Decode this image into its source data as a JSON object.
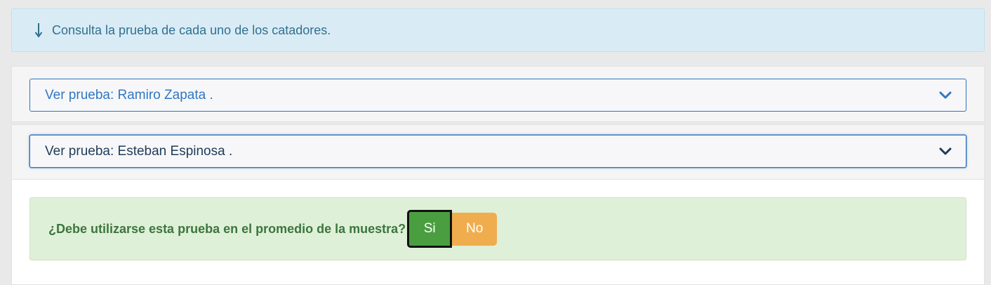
{
  "info_alert": {
    "icon": "arrow-down-icon",
    "text": "Consulta la prueba de cada uno de los catadores."
  },
  "accordion": [
    {
      "label": "Ver prueba: Ramiro Zapata .",
      "icon": "chevron-down-icon",
      "expanded": false
    },
    {
      "label": "Ver prueba: Esteban Espinosa .",
      "icon": "chevron-down-icon",
      "expanded": true
    }
  ],
  "usage_question": {
    "text": "¿Debe utilizarse esta prueba en el promedio de la muestra?",
    "yes_label": "Si",
    "no_label": "No",
    "selected": "Si"
  },
  "colors": {
    "info_bg": "#d9ecf6",
    "success_bg": "#dff0d8",
    "yes_button": "#4a9e40",
    "no_button": "#f0ad4e",
    "accent": "#2f75c0"
  }
}
